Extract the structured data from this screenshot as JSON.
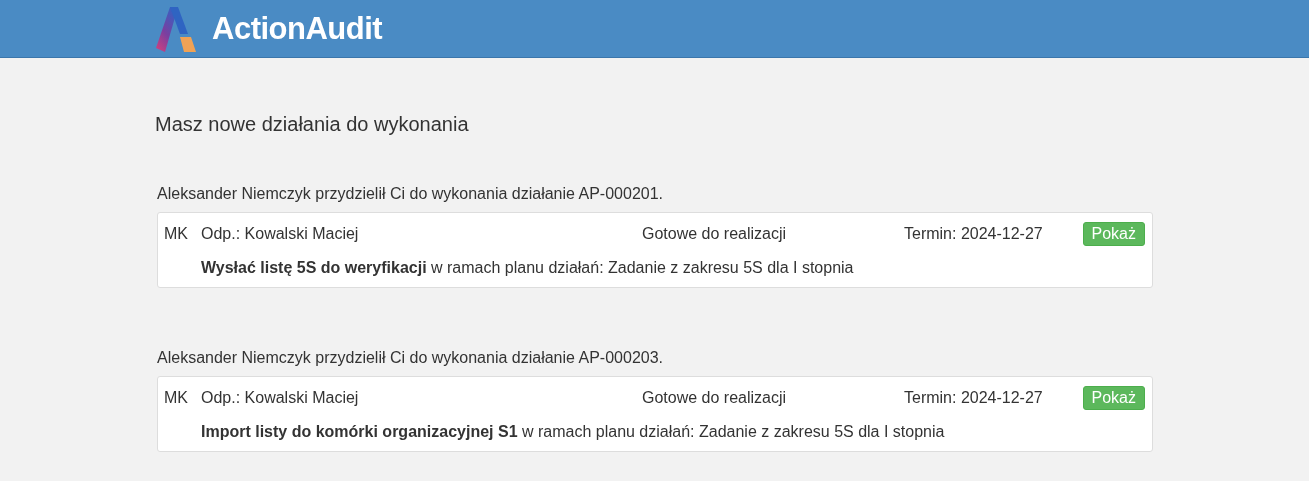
{
  "header": {
    "logo_text": "ActionAudit"
  },
  "heading": "Masz nowe działania do wykonania",
  "notifications": [
    {
      "message": "Aleksander Niemczyk przydzielił Ci do wykonania działanie AP-000201.",
      "initials": "MK",
      "owner": "Odp.: Kowalski Maciej",
      "status": "Gotowe do realizacji",
      "deadline": "Termin: 2024-12-27",
      "button": "Pokaż",
      "description": "**Wysłać listę 5S do weryfikacji** w ramach planu działań: Zadanie z zakresu 5S dla I stopnia"
    },
    {
      "message": "Aleksander Niemczyk przydzielił Ci do wykonania działanie AP-000203.",
      "initials": "MK",
      "owner": "Odp.: Kowalski Maciej",
      "status": "Gotowe do realizacji",
      "deadline": "Termin: 2024-12-27",
      "button": "Pokaż",
      "description": "**Import listy do komórki organizacyjnej S1** w ramach planu działań: Zadanie z zakresu 5S dla I stopnia"
    }
  ]
}
